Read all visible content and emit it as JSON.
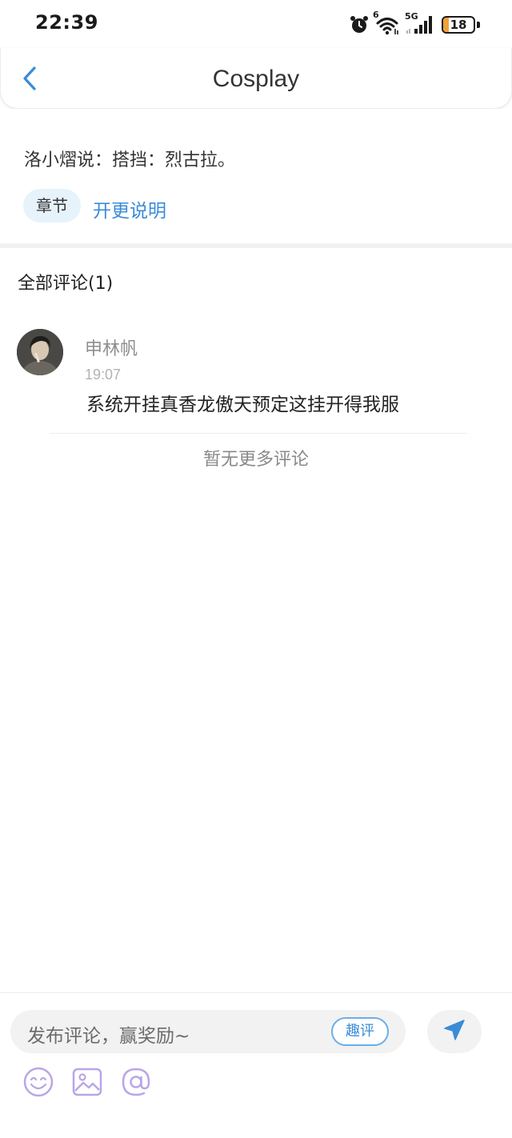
{
  "status_bar": {
    "time": "22:39",
    "wifi_badge": "6",
    "network_label": "5G",
    "battery_level": "18",
    "battery_fraction": 0.18,
    "battery_color": "#f0a03a",
    "icons": [
      "alarm-icon",
      "wifi-icon",
      "cellular-signal-icon",
      "battery-icon"
    ]
  },
  "header": {
    "title": "Cosplay",
    "back_icon": "chevron-left-icon",
    "accent_color": "#3a8bd8"
  },
  "intro": {
    "text": "洛小熠说：搭挡：烈古拉。",
    "chapter_tag": "章节",
    "chapter_link": "开更说明"
  },
  "comments": {
    "heading": "全部评论(1)",
    "items": [
      {
        "user": "申林帆",
        "time": "19:07",
        "text": "系统开挂真香龙傲天预定这挂开得我服"
      }
    ],
    "no_more": "暂无更多评论"
  },
  "composer": {
    "placeholder": "发布评论，赢奖励~",
    "fun_review_label": "趣评",
    "send_icon": "send-icon",
    "tools": [
      "emoji-icon",
      "image-icon",
      "mention-icon"
    ]
  }
}
